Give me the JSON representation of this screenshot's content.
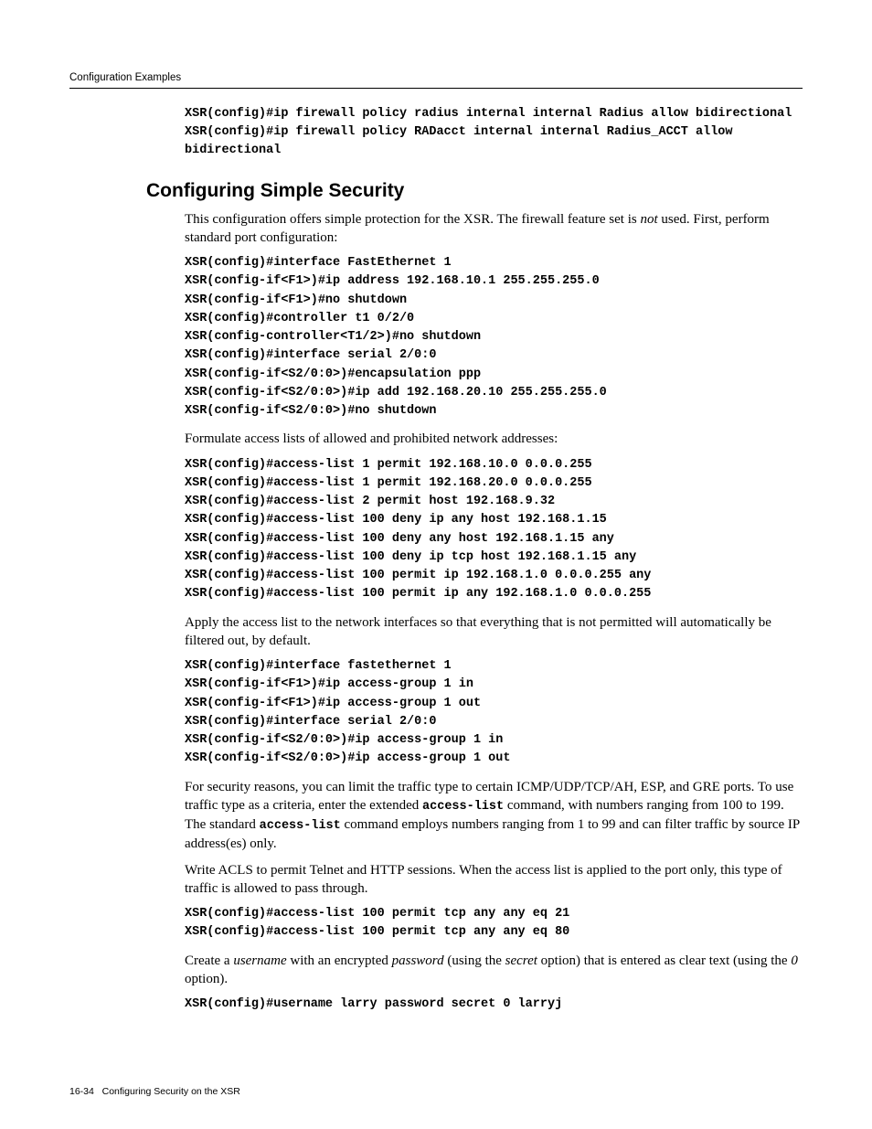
{
  "header": {
    "running_head": "Configuration Examples"
  },
  "top_code": [
    "XSR(config)#ip firewall policy radius internal internal Radius allow bidirectional",
    "XSR(config)#ip firewall policy RADacct internal internal Radius_ACCT allow bidirectional"
  ],
  "section": {
    "title": "Configuring Simple Security",
    "intro_a": "This configuration offers simple protection for the XSR. The firewall feature set is ",
    "intro_em": "not",
    "intro_b": " used. First, perform standard port configuration:",
    "code1": [
      "XSR(config)#interface FastEthernet 1",
      "XSR(config-if<F1>)#ip address 192.168.10.1 255.255.255.0",
      "XSR(config-if<F1>)#no shutdown",
      "XSR(config)#controller t1 0/2/0",
      "XSR(config-controller<T1/2>)#no shutdown",
      "XSR(config)#interface serial 2/0:0",
      "XSR(config-if<S2/0:0>)#encapsulation ppp",
      "XSR(config-if<S2/0:0>)#ip add 192.168.20.10 255.255.255.0",
      "XSR(config-if<S2/0:0>)#no shutdown"
    ],
    "para1": "Formulate access lists of allowed and prohibited network addresses:",
    "code2": [
      "XSR(config)#access-list 1 permit 192.168.10.0 0.0.0.255",
      "XSR(config)#access-list 1 permit 192.168.20.0 0.0.0.255",
      "XSR(config)#access-list 2 permit host 192.168.9.32",
      "XSR(config)#access-list 100 deny ip any host 192.168.1.15",
      "XSR(config)#access-list 100 deny any host 192.168.1.15 any",
      "XSR(config)#access-list 100 deny ip tcp host 192.168.1.15 any",
      "XSR(config)#access-list 100 permit ip 192.168.1.0 0.0.0.255 any",
      "XSR(config)#access-list 100 permit ip any 192.168.1.0 0.0.0.255"
    ],
    "para2": "Apply the access list to the network interfaces so that everything that is not permitted will automatically be filtered out, by default.",
    "code3": [
      "XSR(config)#interface fastethernet 1",
      "XSR(config-if<F1>)#ip access-group 1 in",
      "XSR(config-if<F1>)#ip access-group 1 out",
      "XSR(config)#interface serial 2/0:0",
      "XSR(config-if<S2/0:0>)#ip access-group 1 in",
      "XSR(config-if<S2/0:0>)#ip access-group 1 out"
    ],
    "para3_a": "For security reasons, you can limit the traffic type to certain ICMP/UDP/TCP/AH, ESP, and GRE ports. To use traffic type as a criteria, enter the extended ",
    "para3_mono1": "access-list",
    "para3_b": " command, with numbers ranging from 100 to 199. The standard ",
    "para3_mono2": "access-list",
    "para3_c": " command employs numbers ranging from 1 to 99 and can filter traffic by source IP address(es) only.",
    "para4": "Write ACLS to permit Telnet and HTTP sessions. When the access list is applied to the port only, this type of traffic is allowed to pass through.",
    "code4": [
      "XSR(config)#access-list 100 permit tcp any any eq 21",
      "XSR(config)#access-list 100 permit tcp any any eq 80"
    ],
    "para5_a": "Create a ",
    "para5_em1": "username",
    "para5_b": " with an encrypted ",
    "para5_em2": "password",
    "para5_c": " (using the ",
    "para5_em3": "secret",
    "para5_d": " option) that is entered as clear text (using the ",
    "para5_em4": "0",
    "para5_e": " option).",
    "code5": [
      "XSR(config)#username larry password secret 0 larryj"
    ]
  },
  "footer": {
    "page_number": "16-34",
    "text": "Configuring Security on the XSR"
  }
}
